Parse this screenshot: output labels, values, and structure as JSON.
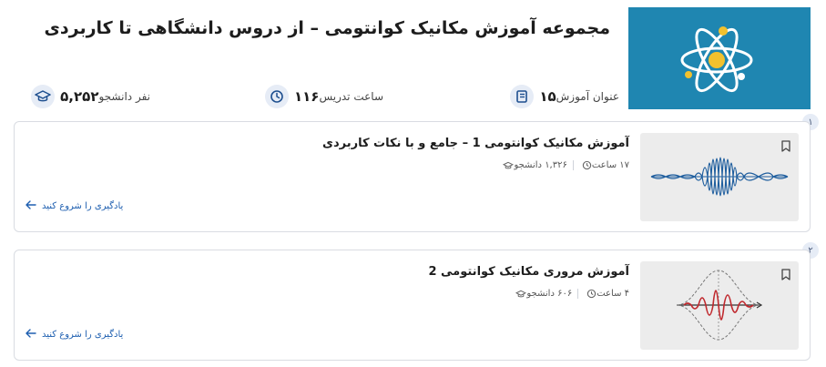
{
  "collection": {
    "title": "مجموعه آموزش مکانیک کوانتومی – از دروس دانشگاهی تا کاربردی"
  },
  "stats": {
    "courses": {
      "value": "۱۵",
      "label": "عنوان آموزش",
      "icon": "book-icon"
    },
    "hours": {
      "value": "۱۱۶",
      "label": "ساعت تدریس",
      "icon": "clock-icon"
    },
    "students": {
      "value": "۵,۲۵۲",
      "label": "نفر دانشجو",
      "icon": "graduation-cap-icon"
    }
  },
  "courses": [
    {
      "index": "۱",
      "title": "آموزش مکانیک کوانتومی 1 – جامع و با نکات کاربردی",
      "students": "۱,۳۲۶ دانشجو",
      "duration": "۱۷ ساعت",
      "cta": "یادگیری را شروع کنید"
    },
    {
      "index": "۲",
      "title": "آموزش مروری مکانیک کوانتومی 2",
      "students": "۶۰۶ دانشجو",
      "duration": "۴ ساعت",
      "cta": "یادگیری را شروع کنید"
    }
  ],
  "colors": {
    "cover_bg": "#1f86b1",
    "accent_blue": "#1e5fb0",
    "wave_blue": "#1f5e9e",
    "wave_red": "#c0282d",
    "atom_yellow": "#f2c12e"
  }
}
